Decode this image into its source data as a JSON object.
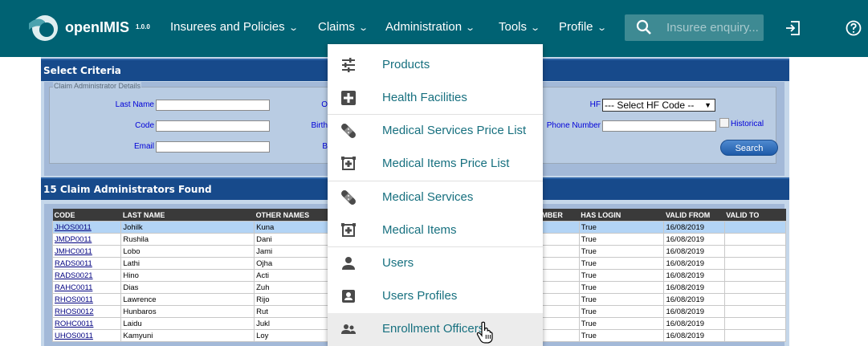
{
  "app": {
    "brand": "openIMIS",
    "version": "1.0.0"
  },
  "nav": {
    "items": [
      {
        "label": "Insurees and Policies"
      },
      {
        "label": "Claims"
      },
      {
        "label": "Administration"
      },
      {
        "label": "Tools"
      },
      {
        "label": "Profile"
      }
    ],
    "search_placeholder": "Insuree enquiry..."
  },
  "criteria": {
    "title": "Select Criteria",
    "legend": "Claim Administrator Details",
    "last_name_label": "Last Name",
    "code_label": "Code",
    "email_label": "Email",
    "col2_labels": [
      "O",
      "Birth",
      "B"
    ],
    "hf_label": "HF",
    "hf_select": "--- Select HF Code --",
    "phone_label": "Phone Number",
    "historical_label": "Historical",
    "search_button": "Search"
  },
  "results": {
    "title": "15 Claim Administrators Found",
    "columns": [
      "CODE",
      "LAST NAME",
      "OTHER NAMES",
      "",
      "MBER",
      "HAS LOGIN",
      "VALID FROM",
      "VALID TO"
    ],
    "rows": [
      {
        "code": "JHOS0011",
        "last": "Johilk",
        "other": "Kuna",
        "login": "True",
        "from": "16/08/2019",
        "to": "",
        "selected": true
      },
      {
        "code": "JMDP0011",
        "last": "Rushila",
        "other": "Dani",
        "login": "True",
        "from": "16/08/2019",
        "to": ""
      },
      {
        "code": "JMHC0011",
        "last": "Lobo",
        "other": "Jami",
        "login": "True",
        "from": "16/08/2019",
        "to": ""
      },
      {
        "code": "RADS0011",
        "last": "Lathi",
        "other": "Ojha",
        "login": "True",
        "from": "16/08/2019",
        "to": ""
      },
      {
        "code": "RADS0021",
        "last": "Hino",
        "other": "Acti",
        "login": "True",
        "from": "16/08/2019",
        "to": ""
      },
      {
        "code": "RAHC0011",
        "last": "Dias",
        "other": "Zuh",
        "login": "True",
        "from": "16/08/2019",
        "to": ""
      },
      {
        "code": "RHOS0011",
        "last": "Lawrence",
        "other": "Rijo",
        "login": "True",
        "from": "16/08/2019",
        "to": ""
      },
      {
        "code": "RHOS0012",
        "last": "Hunbaros",
        "other": "Rut",
        "login": "True",
        "from": "16/08/2019",
        "to": ""
      },
      {
        "code": "ROHC0011",
        "last": "Laidu",
        "other": "Jukl",
        "login": "True",
        "from": "16/08/2019",
        "to": ""
      },
      {
        "code": "UHOS0011",
        "last": "Kamyuni",
        "other": "Loy",
        "login": "True",
        "from": "16/08/2019",
        "to": ""
      }
    ]
  },
  "admin_menu": {
    "items": [
      {
        "label": "Products",
        "icon": "sliders-icon"
      },
      {
        "label": "Health Facilities",
        "icon": "medical-plus-icon"
      },
      {
        "label": "Medical Services Price List",
        "icon": "bandage-icon"
      },
      {
        "label": "Medical Items Price List",
        "icon": "medical-item-icon"
      },
      {
        "label": "Medical Services",
        "icon": "bandage-icon"
      },
      {
        "label": "Medical Items",
        "icon": "medical-item-icon"
      },
      {
        "label": "Users",
        "icon": "person-icon"
      },
      {
        "label": "Users Profiles",
        "icon": "profile-card-icon"
      },
      {
        "label": "Enrollment Officers",
        "icon": "people-icon"
      }
    ]
  },
  "colors": {
    "topbar": "#006273",
    "menu_text": "#17707f",
    "section_header": "#174a8b"
  }
}
